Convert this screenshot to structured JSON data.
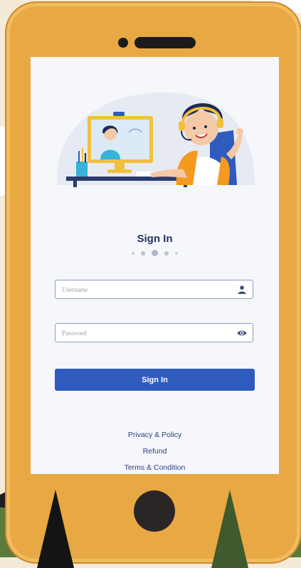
{
  "login": {
    "title": "Sign In",
    "username_placeholder": "Username",
    "password_placeholder": "Password",
    "submit_label": "Sign In"
  },
  "carousel": {
    "dot_count": 5,
    "active_index": 2
  },
  "footer_links": [
    {
      "label": "Privacy & Policy"
    },
    {
      "label": "Refund"
    },
    {
      "label": "Terms & Condition"
    }
  ],
  "icons": {
    "username": "user-icon",
    "password": "eye-icon"
  },
  "colors": {
    "primary": "#2f5bbf",
    "title": "#24345f",
    "phone_body": "#e8a843",
    "screen_bg": "#f5f7fb"
  }
}
